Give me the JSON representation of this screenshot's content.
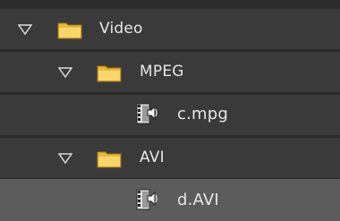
{
  "tree": {
    "items": [
      {
        "label": "Video",
        "type": "folder",
        "expanded": true,
        "depth": 0
      },
      {
        "label": "MPEG",
        "type": "folder",
        "expanded": true,
        "depth": 1
      },
      {
        "label": "c.mpg",
        "type": "media-file",
        "depth": 2
      },
      {
        "label": "AVI",
        "type": "folder",
        "expanded": true,
        "depth": 1
      },
      {
        "label": "d.AVI",
        "type": "media-file",
        "depth": 2,
        "selected": true
      }
    ]
  },
  "icons": {
    "expand": "chevron-down-icon",
    "folder": "folder-icon",
    "media": "video-audio-clip-icon"
  },
  "colors": {
    "row_background": "#3a3a3a",
    "selected_row": "#5c5c5c",
    "text": "#e6e6e6",
    "folder": "#f2c94c"
  }
}
